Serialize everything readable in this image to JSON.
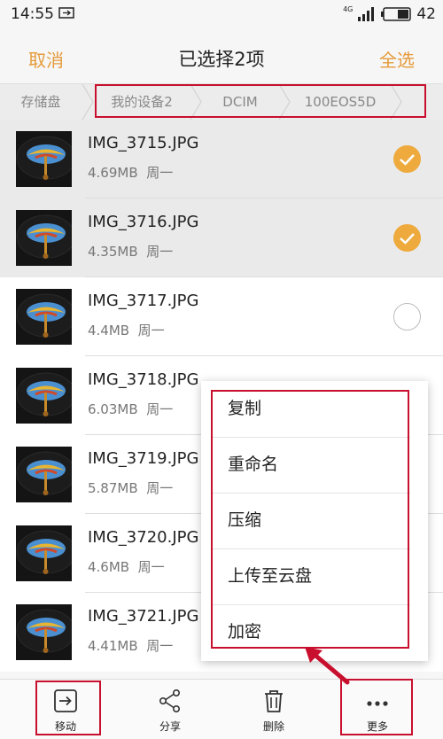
{
  "status_bar": {
    "time": "14:55",
    "network": "4G",
    "battery": "42"
  },
  "header": {
    "cancel_label": "取消",
    "title": "已选择2项",
    "select_all_label": "全选"
  },
  "breadcrumb": [
    "存储盘",
    "我的设备2",
    "DCIM",
    "100EOS5D"
  ],
  "files": [
    {
      "name": "IMG_3715.JPG",
      "size": "4.69MB",
      "day": "周一",
      "selected": true
    },
    {
      "name": "IMG_3716.JPG",
      "size": "4.35MB",
      "day": "周一",
      "selected": true
    },
    {
      "name": "IMG_3717.JPG",
      "size": "4.4MB",
      "day": "周一",
      "selected": false
    },
    {
      "name": "IMG_3718.JPG",
      "size": "6.03MB",
      "day": "周一",
      "selected": false
    },
    {
      "name": "IMG_3719.JPG",
      "size": "5.87MB",
      "day": "周一",
      "selected": false
    },
    {
      "name": "IMG_3720.JPG",
      "size": "4.6MB",
      "day": "周一",
      "selected": false
    },
    {
      "name": "IMG_3721.JPG",
      "size": "4.41MB",
      "day": "周一",
      "selected": false
    }
  ],
  "context_menu": [
    "复制",
    "重命名",
    "压缩",
    "上传至云盘",
    "加密"
  ],
  "toolbar": {
    "move": "移动",
    "share": "分享",
    "delete": "删除",
    "more": "更多"
  },
  "colors": {
    "accent": "#e59b3b",
    "annotation": "#c8102e"
  },
  "icons": [
    "usb-icon",
    "signal-icon",
    "battery-icon",
    "check-icon",
    "move-icon",
    "share-icon",
    "trash-icon",
    "more-icon"
  ]
}
